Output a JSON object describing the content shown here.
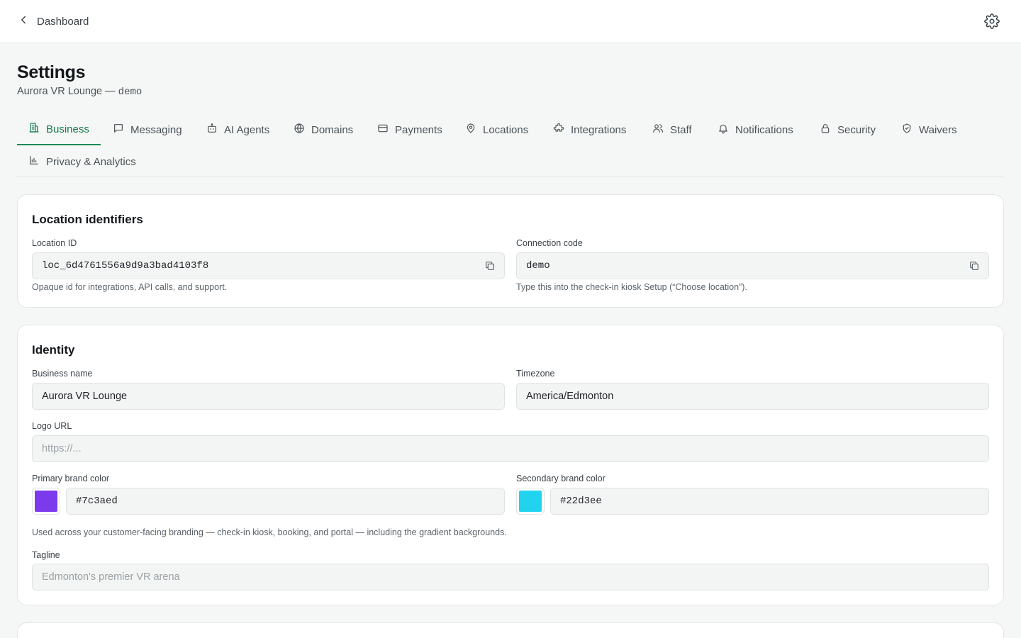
{
  "topbar": {
    "back_label": "Dashboard",
    "back_icon": "chevron-left-icon",
    "settings_icon": "gear-icon"
  },
  "header": {
    "title": "Settings",
    "subtitle_name": "Aurora VR Lounge —",
    "subtitle_code": "demo"
  },
  "tabs": [
    {
      "label": "Business",
      "icon": "building-icon",
      "active": true
    },
    {
      "label": "Messaging",
      "icon": "message-icon"
    },
    {
      "label": "AI Agents",
      "icon": "robot-icon"
    },
    {
      "label": "Domains",
      "icon": "globe-icon"
    },
    {
      "label": "Payments",
      "icon": "credit-card-icon"
    },
    {
      "label": "Locations",
      "icon": "map-pin-icon"
    },
    {
      "label": "Integrations",
      "icon": "puzzle-icon"
    },
    {
      "label": "Staff",
      "icon": "users-icon"
    },
    {
      "label": "Notifications",
      "icon": "bell-icon"
    },
    {
      "label": "Security",
      "icon": "lock-icon"
    },
    {
      "label": "Waivers",
      "icon": "shield-check-icon"
    },
    {
      "label": "Privacy & Analytics",
      "icon": "bar-chart-icon"
    }
  ],
  "location_identifiers": {
    "title": "Location identifiers",
    "location_id": {
      "label": "Location ID",
      "value": "loc_6d4761556a9d9a3bad4103f8",
      "help": "Opaque id for integrations, API calls, and support."
    },
    "connection_code": {
      "label": "Connection code",
      "value": "demo",
      "help": "Type this into the check-in kiosk Setup (“Choose location”)."
    }
  },
  "identity": {
    "title": "Identity",
    "business_name": {
      "label": "Business name",
      "value": "Aurora VR Lounge"
    },
    "timezone": {
      "label": "Timezone",
      "value": "America/Edmonton"
    },
    "logo_url": {
      "label": "Logo URL",
      "placeholder": "https://..."
    },
    "primary_color": {
      "label": "Primary brand color",
      "value": "#7c3aed"
    },
    "secondary_color": {
      "label": "Secondary brand color",
      "value": "#22d3ee"
    },
    "brand_help": "Used across your customer-facing branding — check-in kiosk, booking, and portal — including the gradient backgrounds.",
    "tagline": {
      "label": "Tagline",
      "placeholder": "Edmonton's premier VR arena"
    }
  },
  "colors": {
    "accent": "#1c8a55",
    "page_background": "#f5f7f6"
  }
}
